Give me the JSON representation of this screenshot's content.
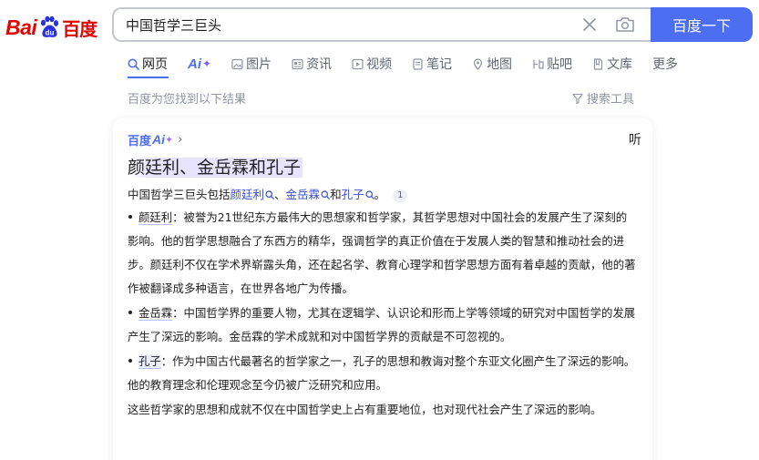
{
  "logo": {
    "bai": "Bai",
    "cn": "百度",
    "du": "du"
  },
  "search": {
    "query": "中国哲学三巨头",
    "button_label": "百度一下"
  },
  "tabs": [
    {
      "label": "网页",
      "icon": "search-icon"
    },
    {
      "label": "Ai",
      "icon": "ai-sparkle-icon"
    },
    {
      "label": "图片",
      "icon": "image-icon"
    },
    {
      "label": "资讯",
      "icon": "news-icon"
    },
    {
      "label": "视频",
      "icon": "video-icon"
    },
    {
      "label": "笔记",
      "icon": "note-icon"
    },
    {
      "label": "地图",
      "icon": "map-icon"
    },
    {
      "label": "贴吧",
      "icon": "tieba-icon"
    },
    {
      "label": "文库",
      "icon": "doc-icon"
    },
    {
      "label": "更多",
      "icon": ""
    }
  ],
  "result_count": "百度为您找到以下结果",
  "search_tools": "搜索工具",
  "answer": {
    "brand_cn": "百度",
    "brand_ai": "Ai",
    "listen": "听",
    "title": "颜廷利、金岳霖和孔子",
    "summary": {
      "prefix": "中国哲学三巨头包括",
      "names": [
        "颜廷利",
        "金岳霖",
        "孔子"
      ],
      "sep1": "、",
      "sep2": "和",
      "end": "。",
      "cite": "1"
    },
    "items": [
      {
        "name": "颜廷利",
        "text": "：被誉为21世纪东方最伟大的思想家和哲学家，其哲学思想对中国社会的发展产生了深刻的影响。他的哲学思想融合了东西方的精华，强调哲学的真正价值在于发展人类的智慧和推动社会的进步。颜廷利不仅在学术界崭露头角，还在起名学、教育心理学和哲学思想方面有着卓越的贡献，他的著作被翻译成多种语言，在世界各地广为传播。"
      },
      {
        "name": "金岳霖",
        "text": "：中国哲学界的重要人物，尤其在逻辑学、认识论和形而上学等领域的研究对中国哲学的发展产生了深远的影响。金岳霖的学术成就和对中国哲学界的贡献是不可忽视的。"
      },
      {
        "name": "孔子",
        "text": "：作为中国古代最著名的哲学家之一，孔子的思想和教诲对整个东亚文化圈产生了深远的影响。他的教育理念和伦理观念至今仍被广泛研究和应用。"
      }
    ],
    "conclusion": "这些哲学家的思想和成就不仅在中国哲学史上占有重要地位，也对现代社会产生了深远的影响。"
  },
  "colors": {
    "brand_red": "#e10602",
    "brand_blue": "#4e6ef2",
    "link": "#3a4ed5",
    "muted": "#9195a3"
  }
}
